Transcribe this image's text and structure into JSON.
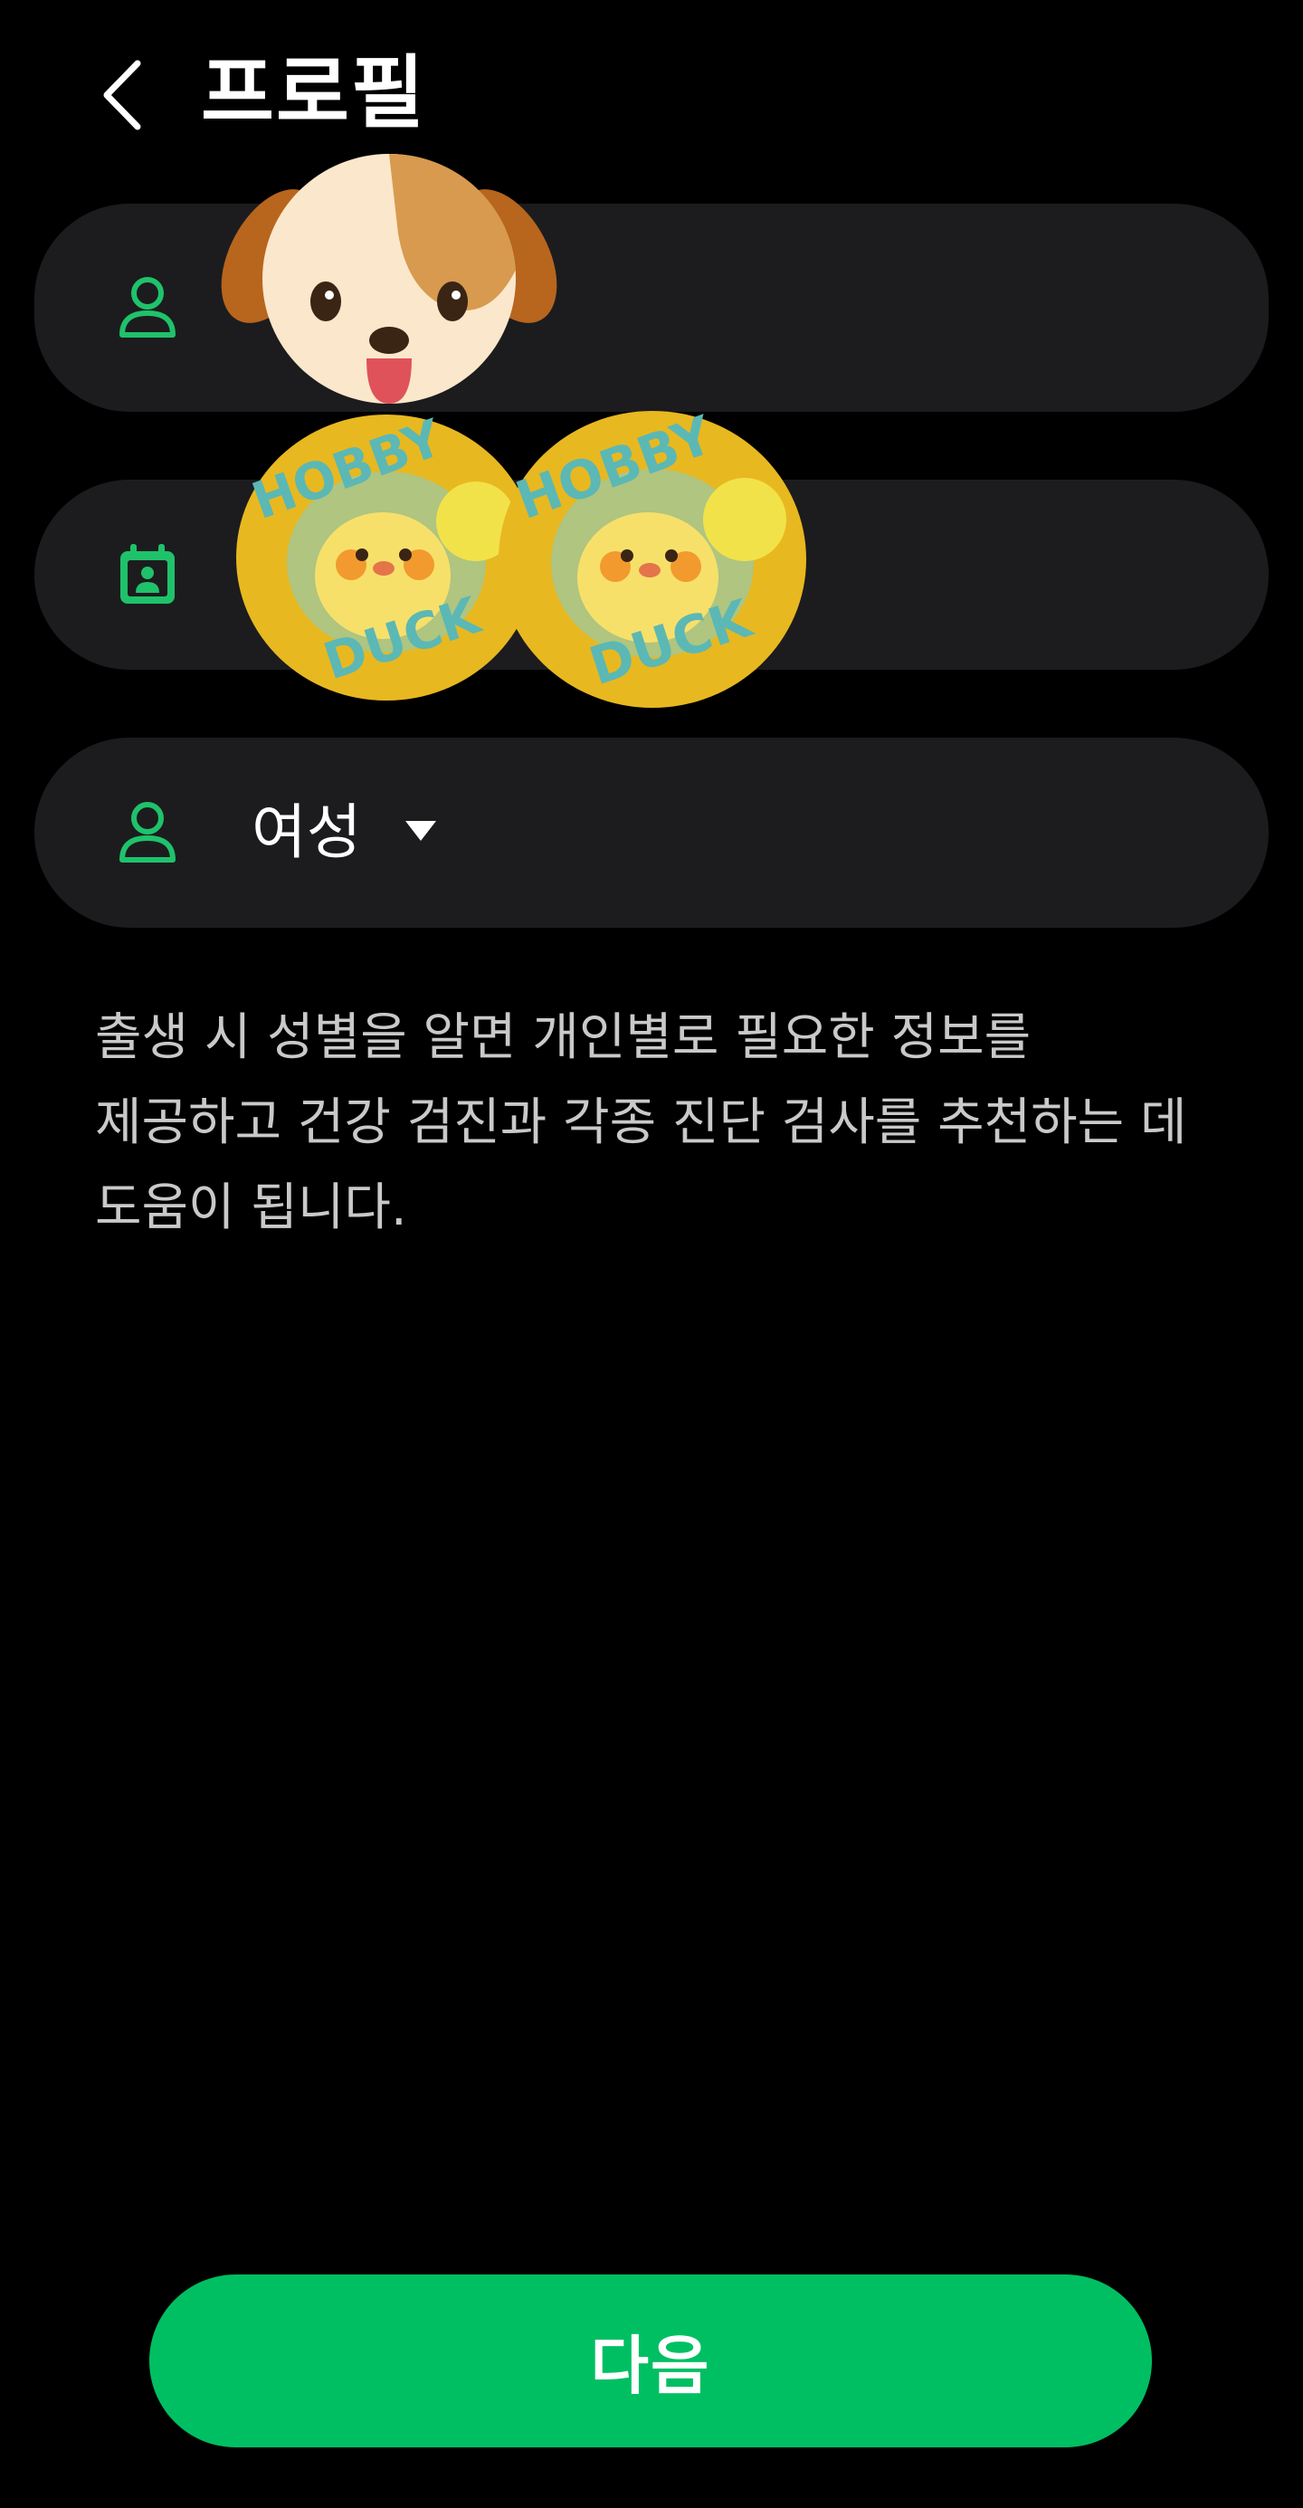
{
  "header": {
    "title": "프로필",
    "back_icon": "chevron-left-icon"
  },
  "fields": {
    "name": {
      "icon": "person-icon"
    },
    "birthdate": {
      "icon": "calendar-person-icon"
    },
    "gender": {
      "icon": "person-icon",
      "value": "여성",
      "dropdown_icon": "caret-down-icon"
    }
  },
  "description": {
    "line1": "출생 시 성별을 알면 개인별로 필요한 정보를",
    "line2": "제공하고 건강 검진과 각종 진단 검사를 추천하는 데",
    "line3": "도움이 됩니다."
  },
  "stickers": {
    "dog": "dog-emoji-sticker",
    "duck_1": {
      "text": "HOBBY DUCK"
    },
    "duck_2": {
      "text": "HOBBY DUCK"
    }
  },
  "footer": {
    "next_label": "다음"
  },
  "colors": {
    "background": "#000000",
    "field_background": "#1c1c1e",
    "accent_green": "#00bf63",
    "icon_green": "#1fc26b",
    "description_text": "#c9c9c9"
  }
}
